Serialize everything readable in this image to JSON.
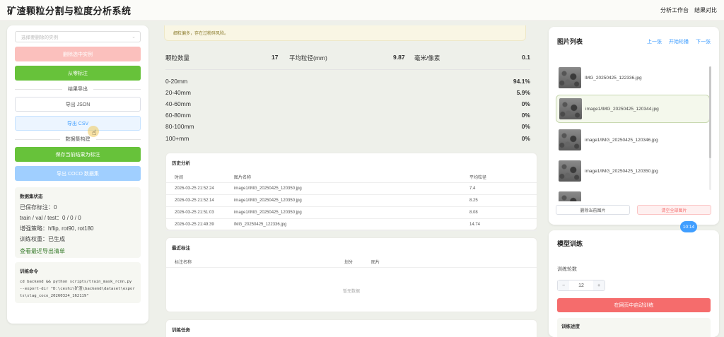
{
  "app": {
    "title": "矿渣颗粒分割与粒度分析系统"
  },
  "top_nav": [
    "分析工作台",
    "结果对比"
  ],
  "left": {
    "select_placeholder": "选择要删除的实例",
    "delete_instance": "删除选中实例",
    "relabel": "从零标注",
    "export_section": "结果导出",
    "export_json": "导出 JSON",
    "export_csv": "导出 CSV",
    "dataset_section": "数据集构建",
    "save_as_label": "保存当前结果为标注",
    "export_coco": "导出 COCO 数据集",
    "status": {
      "title": "数据集状态",
      "saved": "已保存标注：0",
      "split": "train / val / test：0 / 0 / 0",
      "augment": "增强策略：hflip, rot90, rot180",
      "weights": "训练权重：已生成",
      "view_link": "查看最近导出清单"
    },
    "command": {
      "title": "训练命令",
      "text": "cd backend && python scripts/train_mask_rcnn.py --export-dir \"D:\\ceshi\\矿渣\\backend\\dataset\\exports\\slag_coco_20260324_162119\""
    }
  },
  "middle": {
    "warning": "细粒偏多，存在过粉碎风险。",
    "stats": {
      "count_label": "颗粒数量",
      "count_value": "17",
      "avg_label": "平均粒径(mm)",
      "avg_value": "9.87",
      "scale_label": "毫米/像素",
      "scale_value": "0.1"
    },
    "grades": [
      {
        "range": "0-20mm",
        "pct": "94.1%"
      },
      {
        "range": "20-40mm",
        "pct": "5.9%"
      },
      {
        "range": "40-60mm",
        "pct": "0%"
      },
      {
        "range": "60-80mm",
        "pct": "0%"
      },
      {
        "range": "80-100mm",
        "pct": "0%"
      },
      {
        "range": "100+mm",
        "pct": "0%"
      }
    ],
    "history": {
      "title": "历史分析",
      "headers": [
        "时间",
        "图片名称",
        "平均粒径"
      ],
      "rows": [
        [
          "2026-03-25 21:52:24",
          "image1/IMG_20250425_120350.jpg",
          "7.4"
        ],
        [
          "2026-03-25 21:52:14",
          "image1/IMG_20250425_120350.jpg",
          "8.25"
        ],
        [
          "2026-03-25 21:51:03",
          "image1/IMG_20250425_120350.jpg",
          "8.08"
        ],
        [
          "2026-03-25 21:49:39",
          "IMG_20250425_122336.jpg",
          "14.74"
        ]
      ]
    },
    "recent": {
      "title": "最近标注",
      "headers": [
        "标注名称",
        "划分",
        "图片"
      ],
      "empty": "暂无数据"
    },
    "training_task": "训练任务"
  },
  "right": {
    "title": "图片列表",
    "prev": "上一张",
    "play": "开始轮播",
    "next": "下一张",
    "images": [
      "IMG_20250425_122336.jpg",
      "image1/IMG_20250425_120344.jpg",
      "image1/IMG_20250425_120346.jpg",
      "image1/IMG_20250425_120350.jpg"
    ],
    "selected_index": 1,
    "delete_current": "删除当前图片",
    "clear_all": "清空全部图片",
    "time": "10:14",
    "train": {
      "title": "模型训练",
      "epochs_label": "训练轮数",
      "epochs_value": "12",
      "start": "在网页中启动训练",
      "progress_title": "训练进度"
    }
  }
}
